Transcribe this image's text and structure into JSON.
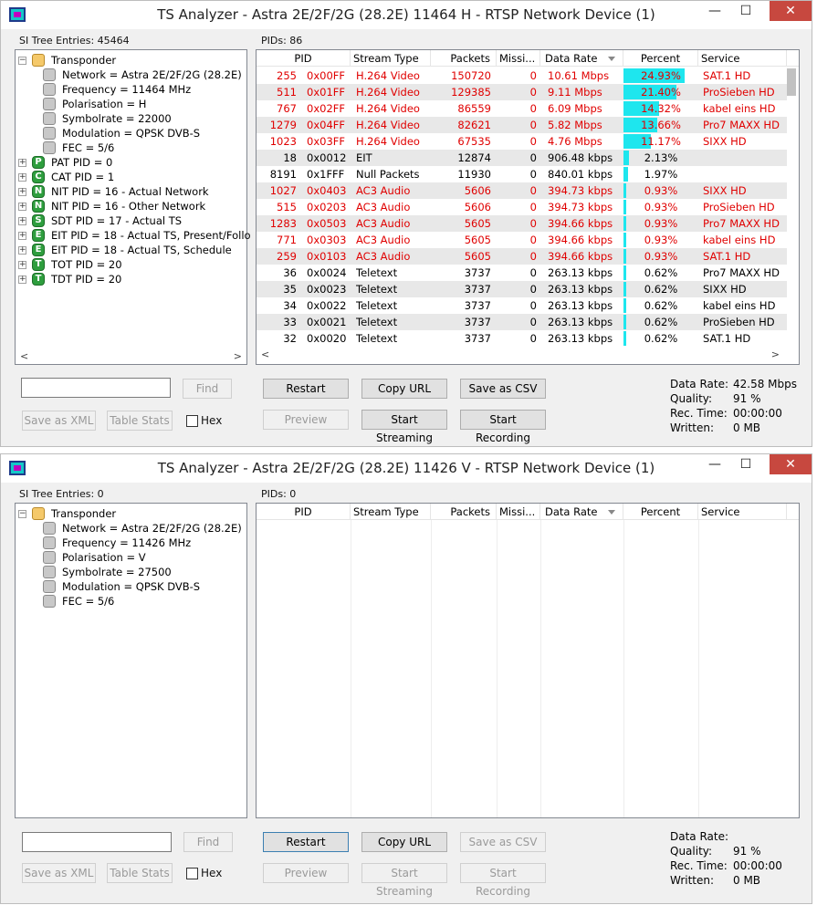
{
  "windows": [
    {
      "title": "TS Analyzer - Astra 2E/2F/2G (28.2E) 11464 H - RTSP Network Device (1)",
      "si_label": "SI Tree Entries: 45464",
      "pids_label": "PIDs: 86",
      "tree": [
        {
          "label": "Transponder",
          "icon": "folder-icon",
          "exp": "−",
          "level": 0
        },
        {
          "label": "Network = Astra 2E/2F/2G (28.2E)",
          "icon": "gray-node-icon",
          "level": 1
        },
        {
          "label": "Frequency = 11464 MHz",
          "icon": "gray-node-icon",
          "level": 1
        },
        {
          "label": "Polarisation = H",
          "icon": "gray-node-icon",
          "level": 1
        },
        {
          "label": "Symbolrate = 22000",
          "icon": "gray-node-icon",
          "level": 1
        },
        {
          "label": "Modulation = QPSK DVB-S",
          "icon": "gray-node-icon",
          "level": 1
        },
        {
          "label": "FEC = 5/6",
          "icon": "gray-node-icon",
          "level": 1
        },
        {
          "label": "PAT PID = 0",
          "icon": "letter-p-icon",
          "letter": "P",
          "exp": "+",
          "level": 0
        },
        {
          "label": "CAT PID = 1",
          "icon": "letter-c-icon",
          "letter": "C",
          "exp": "+",
          "level": 0
        },
        {
          "label": "NIT PID = 16 - Actual Network",
          "icon": "letter-n-icon",
          "letter": "N",
          "exp": "+",
          "level": 0
        },
        {
          "label": "NIT PID = 16 - Other Network",
          "icon": "letter-n-icon",
          "letter": "N",
          "exp": "+",
          "level": 0
        },
        {
          "label": "SDT PID = 17 - Actual TS",
          "icon": "letter-s-icon",
          "letter": "S",
          "exp": "+",
          "level": 0
        },
        {
          "label": "EIT PID = 18 - Actual TS, Present/Follo",
          "icon": "letter-e-icon",
          "letter": "E",
          "exp": "+",
          "level": 0
        },
        {
          "label": "EIT PID = 18 - Actual TS, Schedule",
          "icon": "letter-e-icon",
          "letter": "E",
          "exp": "+",
          "level": 0
        },
        {
          "label": "TOT PID = 20",
          "icon": "letter-t-icon",
          "letter": "T",
          "exp": "+",
          "level": 0
        },
        {
          "label": "TDT PID = 20",
          "icon": "letter-t-icon",
          "letter": "T",
          "exp": "+",
          "level": 0
        }
      ],
      "rows": [
        {
          "pid": "255",
          "hex": "0x00FF",
          "type": "H.264 Video",
          "packets": "150720",
          "missing": "0",
          "rate": "10.61 Mbps",
          "percent": "24.93%",
          "pct": 24.93,
          "service": "SAT.1 HD",
          "red": true
        },
        {
          "pid": "511",
          "hex": "0x01FF",
          "type": "H.264 Video",
          "packets": "129385",
          "missing": "0",
          "rate": "9.11 Mbps",
          "percent": "21.40%",
          "pct": 21.4,
          "service": "ProSieben HD",
          "red": true
        },
        {
          "pid": "767",
          "hex": "0x02FF",
          "type": "H.264 Video",
          "packets": "86559",
          "missing": "0",
          "rate": "6.09 Mbps",
          "percent": "14.32%",
          "pct": 14.32,
          "service": "kabel eins HD",
          "red": true
        },
        {
          "pid": "1279",
          "hex": "0x04FF",
          "type": "H.264 Video",
          "packets": "82621",
          "missing": "0",
          "rate": "5.82 Mbps",
          "percent": "13.66%",
          "pct": 13.66,
          "service": "Pro7 MAXX HD",
          "red": true
        },
        {
          "pid": "1023",
          "hex": "0x03FF",
          "type": "H.264 Video",
          "packets": "67535",
          "missing": "0",
          "rate": "4.76 Mbps",
          "percent": "11.17%",
          "pct": 11.17,
          "service": "SIXX HD",
          "red": true
        },
        {
          "pid": "18",
          "hex": "0x0012",
          "type": "EIT",
          "packets": "12874",
          "missing": "0",
          "rate": "906.48 kbps",
          "percent": "2.13%",
          "pct": 2.13,
          "service": "",
          "red": false
        },
        {
          "pid": "8191",
          "hex": "0x1FFF",
          "type": "Null Packets",
          "packets": "11930",
          "missing": "0",
          "rate": "840.01 kbps",
          "percent": "1.97%",
          "pct": 1.97,
          "service": "",
          "red": false
        },
        {
          "pid": "1027",
          "hex": "0x0403",
          "type": "AC3 Audio",
          "packets": "5606",
          "missing": "0",
          "rate": "394.73 kbps",
          "percent": "0.93%",
          "pct": 0.93,
          "service": "SIXX HD",
          "red": true
        },
        {
          "pid": "515",
          "hex": "0x0203",
          "type": "AC3 Audio",
          "packets": "5606",
          "missing": "0",
          "rate": "394.73 kbps",
          "percent": "0.93%",
          "pct": 0.93,
          "service": "ProSieben HD",
          "red": true
        },
        {
          "pid": "1283",
          "hex": "0x0503",
          "type": "AC3 Audio",
          "packets": "5605",
          "missing": "0",
          "rate": "394.66 kbps",
          "percent": "0.93%",
          "pct": 0.93,
          "service": "Pro7 MAXX HD",
          "red": true
        },
        {
          "pid": "771",
          "hex": "0x0303",
          "type": "AC3 Audio",
          "packets": "5605",
          "missing": "0",
          "rate": "394.66 kbps",
          "percent": "0.93%",
          "pct": 0.93,
          "service": "kabel eins HD",
          "red": true
        },
        {
          "pid": "259",
          "hex": "0x0103",
          "type": "AC3 Audio",
          "packets": "5605",
          "missing": "0",
          "rate": "394.66 kbps",
          "percent": "0.93%",
          "pct": 0.93,
          "service": "SAT.1 HD",
          "red": true
        },
        {
          "pid": "36",
          "hex": "0x0024",
          "type": "Teletext",
          "packets": "3737",
          "missing": "0",
          "rate": "263.13 kbps",
          "percent": "0.62%",
          "pct": 0.62,
          "service": "Pro7 MAXX HD",
          "red": false
        },
        {
          "pid": "35",
          "hex": "0x0023",
          "type": "Teletext",
          "packets": "3737",
          "missing": "0",
          "rate": "263.13 kbps",
          "percent": "0.62%",
          "pct": 0.62,
          "service": "SIXX HD",
          "red": false
        },
        {
          "pid": "34",
          "hex": "0x0022",
          "type": "Teletext",
          "packets": "3737",
          "missing": "0",
          "rate": "263.13 kbps",
          "percent": "0.62%",
          "pct": 0.62,
          "service": "kabel eins HD",
          "red": false
        },
        {
          "pid": "33",
          "hex": "0x0021",
          "type": "Teletext",
          "packets": "3737",
          "missing": "0",
          "rate": "263.13 kbps",
          "percent": "0.62%",
          "pct": 0.62,
          "service": "ProSieben HD",
          "red": false
        },
        {
          "pid": "32",
          "hex": "0x0020",
          "type": "Teletext",
          "packets": "3737",
          "missing": "0",
          "rate": "263.13 kbps",
          "percent": "0.62%",
          "pct": 0.62,
          "service": "SAT.1 HD",
          "red": false
        }
      ],
      "stats": {
        "data_rate_label": "Data Rate:",
        "data_rate": "42.58 Mbps",
        "quality_label": "Quality:",
        "quality": "91 %",
        "rec_time_label": "Rec. Time:",
        "rec_time": "00:00:00",
        "written_label": "Written:",
        "written": "0 MB"
      },
      "csv_enabled": true,
      "streaming_enabled": true
    },
    {
      "title": "TS Analyzer - Astra 2E/2F/2G (28.2E) 11426 V - RTSP Network Device (1)",
      "si_label": "SI Tree Entries: 0",
      "pids_label": "PIDs: 0",
      "tree": [
        {
          "label": "Transponder",
          "icon": "folder-icon",
          "exp": "−",
          "level": 0
        },
        {
          "label": "Network = Astra 2E/2F/2G (28.2E)",
          "icon": "gray-node-icon",
          "level": 1
        },
        {
          "label": "Frequency = 11426 MHz",
          "icon": "gray-node-icon",
          "level": 1
        },
        {
          "label": "Polarisation = V",
          "icon": "gray-node-icon",
          "level": 1
        },
        {
          "label": "Symbolrate = 27500",
          "icon": "gray-node-icon",
          "level": 1
        },
        {
          "label": "Modulation = QPSK DVB-S",
          "icon": "gray-node-icon",
          "level": 1
        },
        {
          "label": "FEC = 5/6",
          "icon": "gray-node-icon",
          "level": 1
        }
      ],
      "rows": [],
      "stats": {
        "data_rate_label": "Data Rate:",
        "data_rate": "",
        "quality_label": "Quality:",
        "quality": "91 %",
        "rec_time_label": "Rec. Time:",
        "rec_time": "00:00:00",
        "written_label": "Written:",
        "written": "0 MB"
      },
      "csv_enabled": false,
      "streaming_enabled": false
    }
  ],
  "columns": {
    "pid": "PID",
    "type": "Stream Type",
    "packets": "Packets",
    "missing": "Missi...",
    "rate": "Data Rate",
    "percent": "Percent",
    "service": "Service"
  },
  "buttons": {
    "find": "Find",
    "save_xml": "Save as XML",
    "table_stats": "Table Stats",
    "hex": "Hex",
    "restart": "Restart",
    "copy_url": "Copy URL",
    "save_csv": "Save as CSV",
    "preview": "Preview",
    "start_streaming": "Start Streaming",
    "start_recording": "Start Recording"
  },
  "titlebar": {
    "minimize": "—",
    "maximize": "☐",
    "close": "✕"
  },
  "colors": {
    "red_text": "#e00000",
    "percent_bar": "#1ee6ee",
    "close_button": "#c7483f",
    "alt_row": "#e8e8e8"
  }
}
